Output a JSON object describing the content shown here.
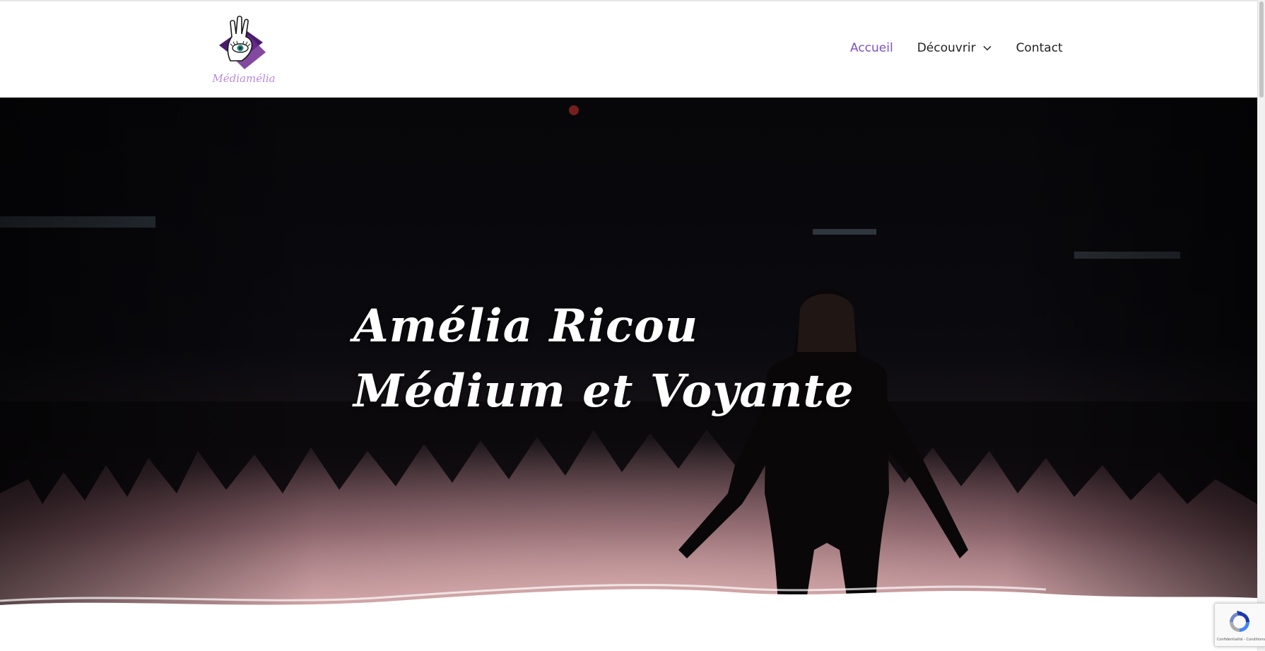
{
  "header": {
    "logo_text": "Médiamélia",
    "nav": [
      {
        "label": "Accueil",
        "active": true
      },
      {
        "label": "Découvrir",
        "has_dropdown": true
      },
      {
        "label": "Contact"
      }
    ]
  },
  "hero": {
    "title_line1": "Amélia Ricou",
    "title_line2": "Médium et Voyante"
  },
  "recaptcha": {
    "links": "Confidentialité - Conditions"
  },
  "colors": {
    "accent": "#7b4fc4",
    "text": "#222222",
    "hero_text": "#ffffff"
  },
  "icons": {
    "dropdown": "chevron-down-icon",
    "recaptcha": "recaptcha-icon",
    "logo": "hand-eye-logo"
  }
}
